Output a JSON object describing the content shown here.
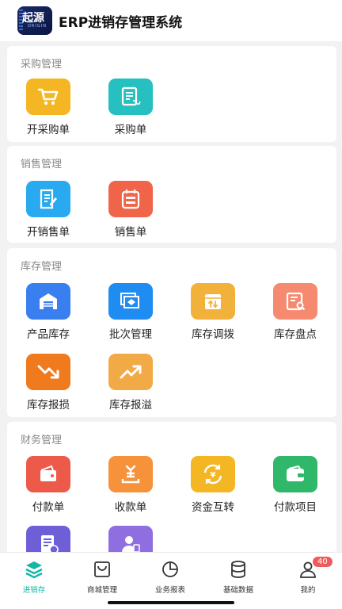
{
  "header": {
    "logo_text": "起源",
    "logo_sub": "ORIGIN",
    "title": "ERP进销存管理系统"
  },
  "sections": {
    "purchase": {
      "title": "采购管理",
      "items": [
        {
          "label": "开采购单",
          "icon": "cart-icon",
          "color": "#f5b623"
        },
        {
          "label": "采购单",
          "icon": "purchase-list-icon",
          "color": "#26c0c0"
        }
      ]
    },
    "sales": {
      "title": "销售管理",
      "items": [
        {
          "label": "开销售单",
          "icon": "edit-doc-icon",
          "color": "#29aaf0"
        },
        {
          "label": "销售单",
          "icon": "sales-list-icon",
          "color": "#f0644a"
        }
      ]
    },
    "inventory": {
      "title": "库存管理",
      "items": [
        {
          "label": "产品库存",
          "icon": "warehouse-icon",
          "color": "#3a7ff0"
        },
        {
          "label": "批次管理",
          "icon": "batch-icon",
          "color": "#1e8cf0"
        },
        {
          "label": "库存调拨",
          "icon": "transfer-box-icon",
          "color": "#f2b13a"
        },
        {
          "label": "库存盘点",
          "icon": "stocktake-icon",
          "color": "#f58a70"
        },
        {
          "label": "库存报损",
          "icon": "trend-down-icon",
          "color": "#f07a1e"
        },
        {
          "label": "库存报溢",
          "icon": "trend-up-icon",
          "color": "#f2aa46"
        }
      ]
    },
    "finance": {
      "title": "财务管理",
      "items": [
        {
          "label": "付款单",
          "icon": "wallet-icon",
          "color": "#ee5a4a"
        },
        {
          "label": "收款单",
          "icon": "receive-icon",
          "color": "#f5923a"
        },
        {
          "label": "资金互转",
          "icon": "exchange-icon",
          "color": "#f5b623"
        },
        {
          "label": "付款项目",
          "icon": "pay-item-icon",
          "color": "#2fb86a"
        },
        {
          "label": "",
          "icon": "expense-doc-icon",
          "color": "#6f5fd6"
        },
        {
          "label": "",
          "icon": "user-card-icon",
          "color": "#8f6ee0"
        }
      ]
    }
  },
  "tabbar": [
    {
      "label": "进销存",
      "icon": "layers-icon",
      "active": true
    },
    {
      "label": "商城管理",
      "icon": "shopping-bag-icon"
    },
    {
      "label": "业务报表",
      "icon": "pie-chart-icon"
    },
    {
      "label": "基础数据",
      "icon": "database-icon"
    },
    {
      "label": "我的",
      "icon": "user-icon",
      "badge": "40"
    }
  ],
  "colors": {
    "accent": "#16b6a6",
    "badge": "#f05a5a"
  }
}
